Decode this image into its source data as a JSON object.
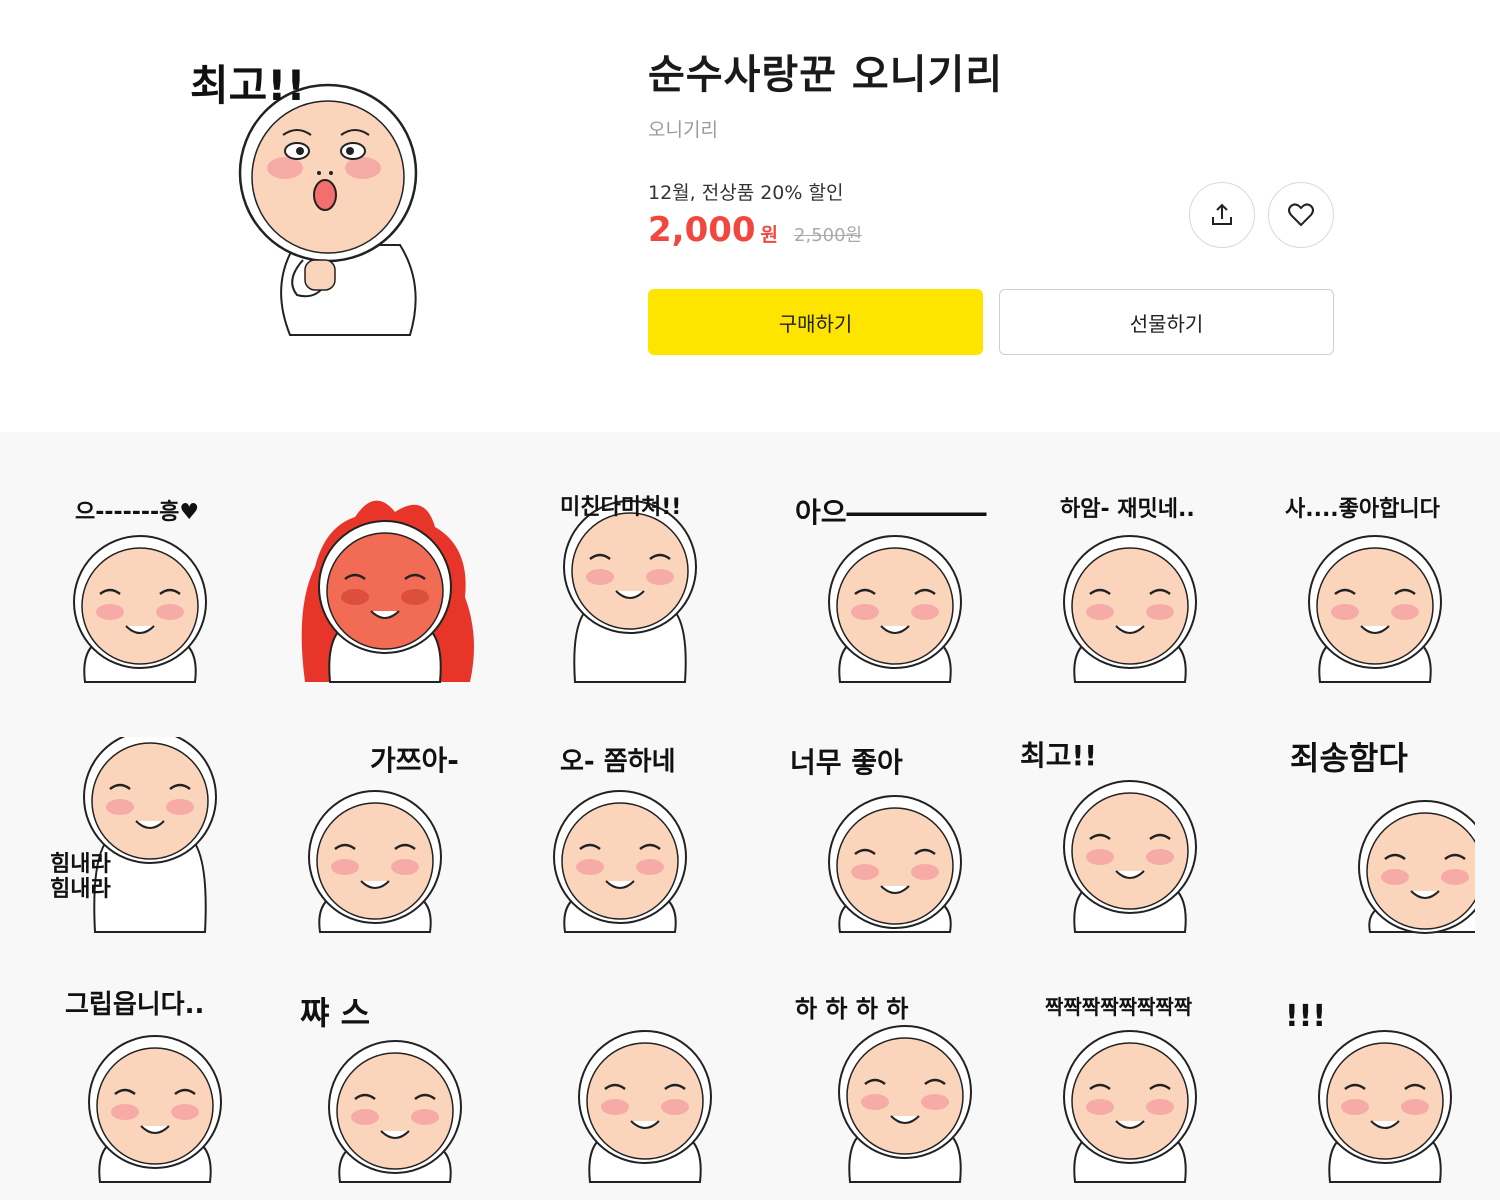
{
  "product": {
    "title": "순수사랑꾼 오니기리",
    "author": "오니기리",
    "promo": "12월, 전상품 20% 할인",
    "price": "2,000",
    "currency": "원",
    "original_price": "2,500원",
    "hero_caption": "최고!!"
  },
  "actions": {
    "share_icon": "share-icon",
    "like_icon": "heart-icon",
    "buy_label": "구매하기",
    "gift_label": "선물하기",
    "buy_color": "#fee500"
  },
  "stickers": [
    {
      "caption": "으-------흥♥"
    },
    {
      "caption": ""
    },
    {
      "caption": "미친다미쳐!!"
    },
    {
      "caption": "아으―――――"
    },
    {
      "caption": "하암- 재밋네.."
    },
    {
      "caption": "사....좋아합니다"
    },
    {
      "caption": "힘내라 힘내라"
    },
    {
      "caption": "가쯔아-"
    },
    {
      "caption": "오- 쫌하네"
    },
    {
      "caption": "너무    좋아"
    },
    {
      "caption": "최고!!"
    },
    {
      "caption": "죄송함다"
    },
    {
      "caption": "그립읍니다.."
    },
    {
      "caption": "쨔          스"
    },
    {
      "caption": ""
    },
    {
      "caption": "하 하 하 하"
    },
    {
      "caption": "짝짝짝짝짝짝짝짝"
    },
    {
      "caption": "!!!"
    }
  ]
}
